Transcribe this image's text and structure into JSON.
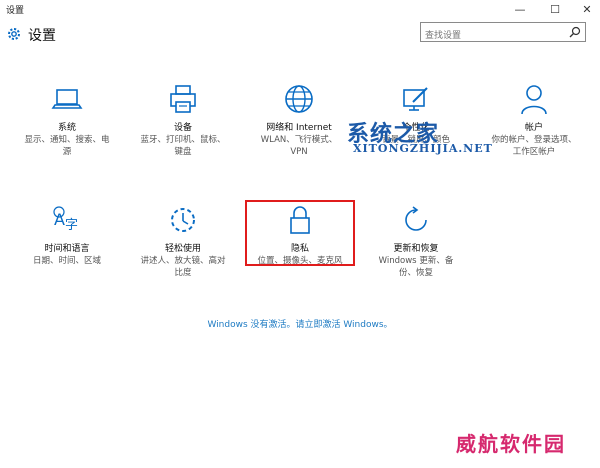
{
  "window": {
    "title": "设置",
    "min": "—",
    "max": "☐",
    "close": "✕"
  },
  "header": {
    "title": "设置",
    "search_placeholder": "查找设置"
  },
  "tiles": [
    {
      "icon": "laptop-icon",
      "name": "系统",
      "desc": "显示、通知、搜索、电源"
    },
    {
      "icon": "printer-icon",
      "name": "设备",
      "desc": "蓝牙、打印机、鼠标、键盘"
    },
    {
      "icon": "globe-icon",
      "name": "网络和 Internet",
      "desc": "WLAN、飞行模式、VPN"
    },
    {
      "icon": "personalization-icon",
      "name": "个性化",
      "desc": "背景、锁屏、颜色"
    },
    {
      "icon": "person-icon",
      "name": "帐户",
      "desc": "你的帐户、登录选项、工作区帐户"
    },
    {
      "icon": "time-language-icon",
      "name": "时间和语言",
      "desc": "日期、时间、区域"
    },
    {
      "icon": "ease-of-access-icon",
      "name": "轻松使用",
      "desc": "讲述人、放大镜、高对比度"
    },
    {
      "icon": "lock-icon",
      "name": "隐私",
      "desc": "位置、摄像头、麦克风"
    },
    {
      "icon": "refresh-icon",
      "name": "更新和恢复",
      "desc": "Windows 更新、备份、恢复"
    }
  ],
  "activation_link": "Windows 没有激活。请立即激活 Windows。",
  "watermark": {
    "brand": "系统之家",
    "site": "XITONGZHIJIA.NET",
    "corner": "威航软件园"
  },
  "colors": {
    "accent": "#1e7bc3",
    "highlight_border": "#e01c1c",
    "icon": "#0a6cc4"
  }
}
